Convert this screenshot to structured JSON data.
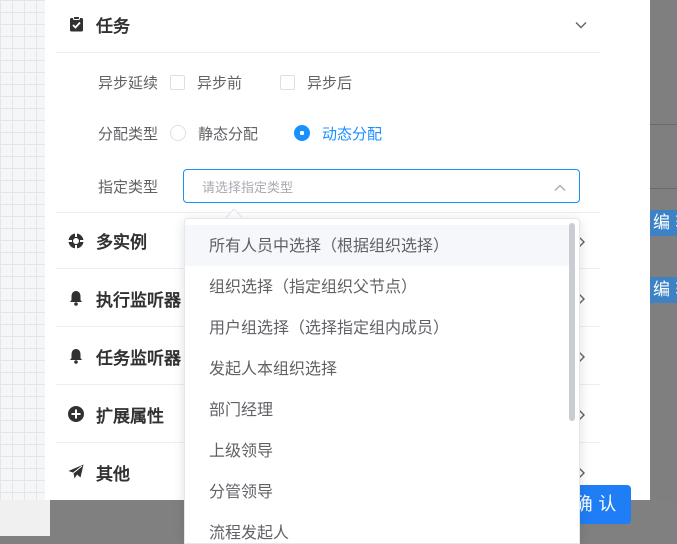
{
  "task_section": {
    "title": "任务",
    "async_label": "异步延续",
    "async_options": [
      "异步前",
      "异步后"
    ],
    "assign_type_label": "分配类型",
    "assign_options": [
      {
        "label": "静态分配",
        "checked": false
      },
      {
        "label": "动态分配",
        "checked": true
      }
    ],
    "designate_label": "指定类型",
    "designate_placeholder": "请选择指定类型"
  },
  "groups": [
    {
      "title": "多实例",
      "icon": "gear-icon"
    },
    {
      "title": "执行监听器",
      "icon": "bell-icon"
    },
    {
      "title": "任务监听器",
      "icon": "bell-icon"
    },
    {
      "title": "扩展属性",
      "icon": "plus-circle-icon"
    },
    {
      "title": "其他",
      "icon": "paper-plane-icon"
    }
  ],
  "dropdown_options": [
    "所有人员中选择（根据组织选择）",
    "组织选择（指定组织父节点）",
    "用户组选择（选择指定组内成员）",
    "发起人本组织选择",
    "部门经理",
    "上级领导",
    "分管领导",
    "流程发起人"
  ],
  "background": {
    "edit_tag": "编 辑",
    "confirm_label": "确 认"
  },
  "colors": {
    "primary": "#1890ff",
    "button": "#1f7ef5",
    "text": "#606266",
    "title": "#303133"
  }
}
